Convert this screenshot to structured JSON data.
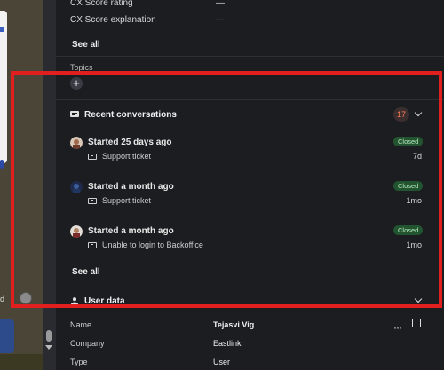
{
  "summary": {
    "rows": [
      {
        "label": "CX Score rating",
        "value": "—"
      },
      {
        "label": "CX Score explanation",
        "value": "—"
      }
    ],
    "see_all": "See all"
  },
  "topics": {
    "label": "Topics",
    "add_symbol": "+"
  },
  "recent": {
    "title": "Recent conversations",
    "count": "17",
    "items": [
      {
        "title": "Started 25 days ago",
        "subject": "Support ticket",
        "status": "Closed",
        "age": "7d"
      },
      {
        "title": "Started a month ago",
        "subject": "Support ticket",
        "status": "Closed",
        "age": "1mo"
      },
      {
        "title": "Started a month ago",
        "subject": "Unable to login to Backoffice",
        "status": "Closed",
        "age": "1mo"
      }
    ],
    "see_all": "See all"
  },
  "user_data": {
    "title": "User data",
    "more_symbol": "···",
    "fields": [
      {
        "label": "Name",
        "value": "Tejasvi Vig"
      },
      {
        "label": "Company",
        "value": "Eastlink"
      },
      {
        "label": "Type",
        "value": "User"
      }
    ]
  },
  "left_strip": {
    "label": "d"
  },
  "colors": {
    "highlight": "#e21f1f",
    "status_bg": "#22542f",
    "count_fg": "#ff7d56"
  }
}
